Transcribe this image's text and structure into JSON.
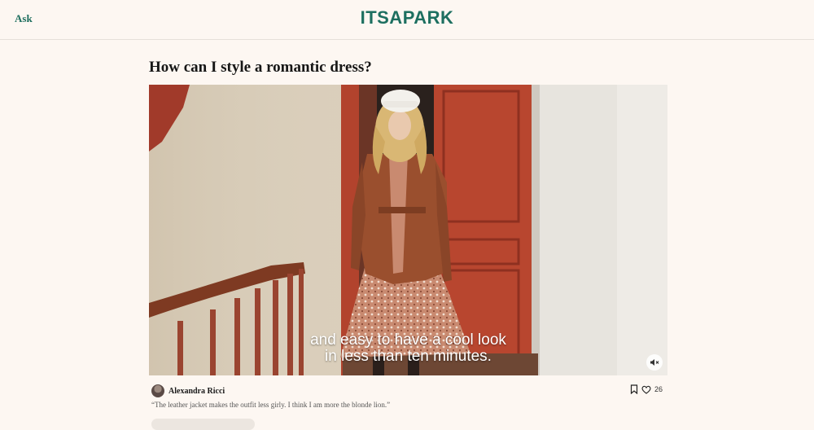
{
  "header": {
    "ask_label": "Ask",
    "logo": "ITSAPARK"
  },
  "question": {
    "title": "How can I style a romantic dress?"
  },
  "video": {
    "caption_line1": "and easy to have a cool look",
    "caption_line2": "in less than ten minutes.",
    "mute_icon": "speaker-muted-icon"
  },
  "answer": {
    "author": "Alexandra Ricci",
    "likes": "26",
    "quote": "“The leather jacket makes the outfit less girly. I think I am more the blonde lion.”",
    "bookmark_icon": "bookmark-icon",
    "like_icon": "heart-icon"
  },
  "colors": {
    "brand": "#1d6f60",
    "background": "#fdf7f2"
  }
}
